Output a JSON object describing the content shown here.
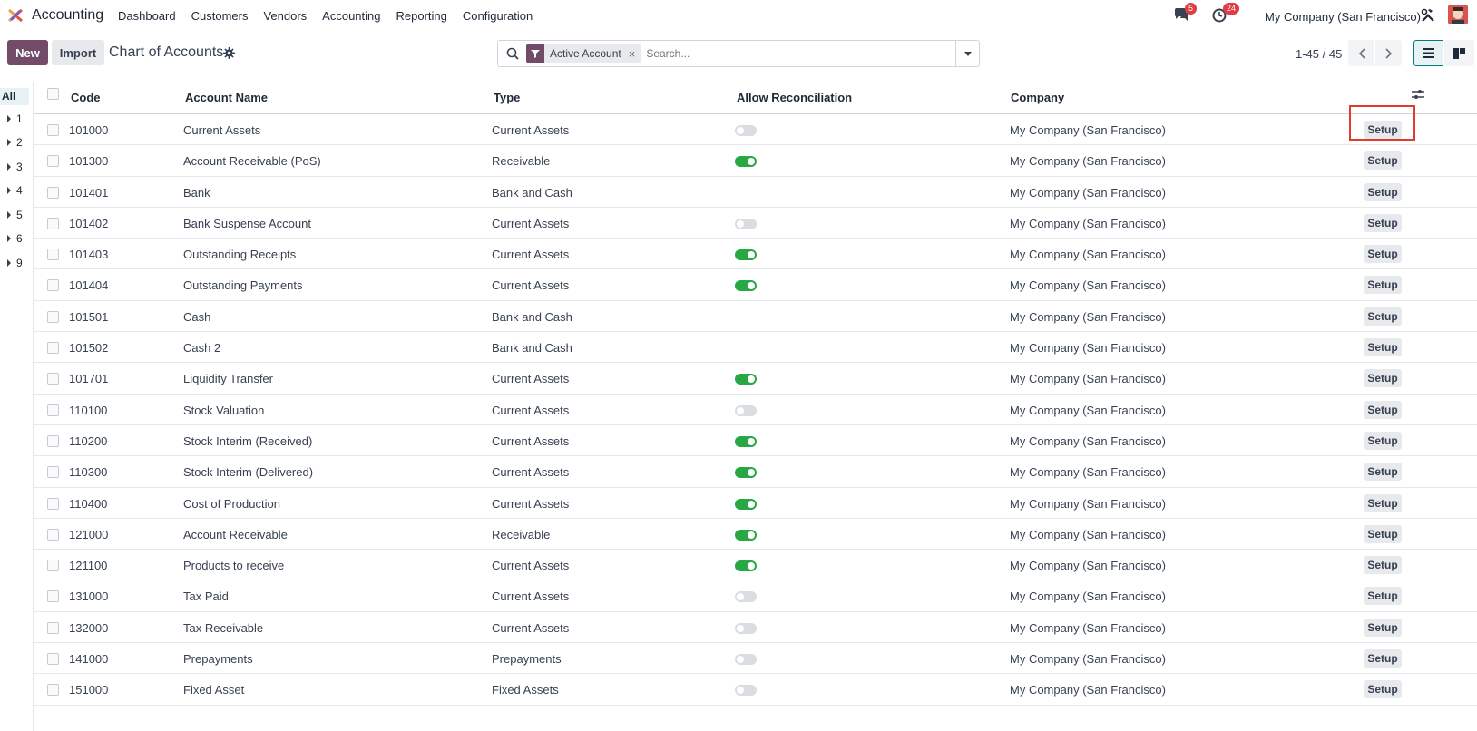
{
  "navbar": {
    "app_name": "Accounting",
    "menu": [
      "Dashboard",
      "Customers",
      "Vendors",
      "Accounting",
      "Reporting",
      "Configuration"
    ],
    "messages_badge": "5",
    "activities_badge": "24",
    "company": "My Company (San Francisco)",
    "colors": {
      "accent": "#714b67",
      "badge": "#e03a45"
    }
  },
  "control_panel": {
    "new_label": "New",
    "import_label": "Import",
    "title": "Chart of Accounts",
    "facet_label": "Active Account",
    "search_placeholder": "Search...",
    "pager": "1-45 / 45"
  },
  "side_panel": {
    "all_label": "All",
    "groups": [
      "1",
      "2",
      "3",
      "4",
      "5",
      "6",
      "9"
    ]
  },
  "table": {
    "headers": {
      "code": "Code",
      "name": "Account Name",
      "type": "Type",
      "reconcile": "Allow Reconciliation",
      "company": "Company"
    },
    "setup_label": "Setup",
    "rows": [
      {
        "code": "101000",
        "name": "Current Assets",
        "type": "Current Assets",
        "reconcile": "off",
        "company": "My Company (San Francisco)"
      },
      {
        "code": "101300",
        "name": "Account Receivable (PoS)",
        "type": "Receivable",
        "reconcile": "on",
        "company": "My Company (San Francisco)"
      },
      {
        "code": "101401",
        "name": "Bank",
        "type": "Bank and Cash",
        "reconcile": "none",
        "company": "My Company (San Francisco)"
      },
      {
        "code": "101402",
        "name": "Bank Suspense Account",
        "type": "Current Assets",
        "reconcile": "off",
        "company": "My Company (San Francisco)"
      },
      {
        "code": "101403",
        "name": "Outstanding Receipts",
        "type": "Current Assets",
        "reconcile": "on",
        "company": "My Company (San Francisco)"
      },
      {
        "code": "101404",
        "name": "Outstanding Payments",
        "type": "Current Assets",
        "reconcile": "on",
        "company": "My Company (San Francisco)"
      },
      {
        "code": "101501",
        "name": "Cash",
        "type": "Bank and Cash",
        "reconcile": "none",
        "company": "My Company (San Francisco)"
      },
      {
        "code": "101502",
        "name": "Cash 2",
        "type": "Bank and Cash",
        "reconcile": "none",
        "company": "My Company (San Francisco)"
      },
      {
        "code": "101701",
        "name": "Liquidity Transfer",
        "type": "Current Assets",
        "reconcile": "on",
        "company": "My Company (San Francisco)"
      },
      {
        "code": "110100",
        "name": "Stock Valuation",
        "type": "Current Assets",
        "reconcile": "off",
        "company": "My Company (San Francisco)"
      },
      {
        "code": "110200",
        "name": "Stock Interim (Received)",
        "type": "Current Assets",
        "reconcile": "on",
        "company": "My Company (San Francisco)"
      },
      {
        "code": "110300",
        "name": "Stock Interim (Delivered)",
        "type": "Current Assets",
        "reconcile": "on",
        "company": "My Company (San Francisco)"
      },
      {
        "code": "110400",
        "name": "Cost of Production",
        "type": "Current Assets",
        "reconcile": "on",
        "company": "My Company (San Francisco)"
      },
      {
        "code": "121000",
        "name": "Account Receivable",
        "type": "Receivable",
        "reconcile": "on",
        "company": "My Company (San Francisco)"
      },
      {
        "code": "121100",
        "name": "Products to receive",
        "type": "Current Assets",
        "reconcile": "on",
        "company": "My Company (San Francisco)"
      },
      {
        "code": "131000",
        "name": "Tax Paid",
        "type": "Current Assets",
        "reconcile": "off",
        "company": "My Company (San Francisco)"
      },
      {
        "code": "132000",
        "name": "Tax Receivable",
        "type": "Current Assets",
        "reconcile": "off",
        "company": "My Company (San Francisco)"
      },
      {
        "code": "141000",
        "name": "Prepayments",
        "type": "Prepayments",
        "reconcile": "off",
        "company": "My Company (San Francisco)"
      },
      {
        "code": "151000",
        "name": "Fixed Asset",
        "type": "Fixed Assets",
        "reconcile": "off",
        "company": "My Company (San Francisco)"
      }
    ]
  }
}
